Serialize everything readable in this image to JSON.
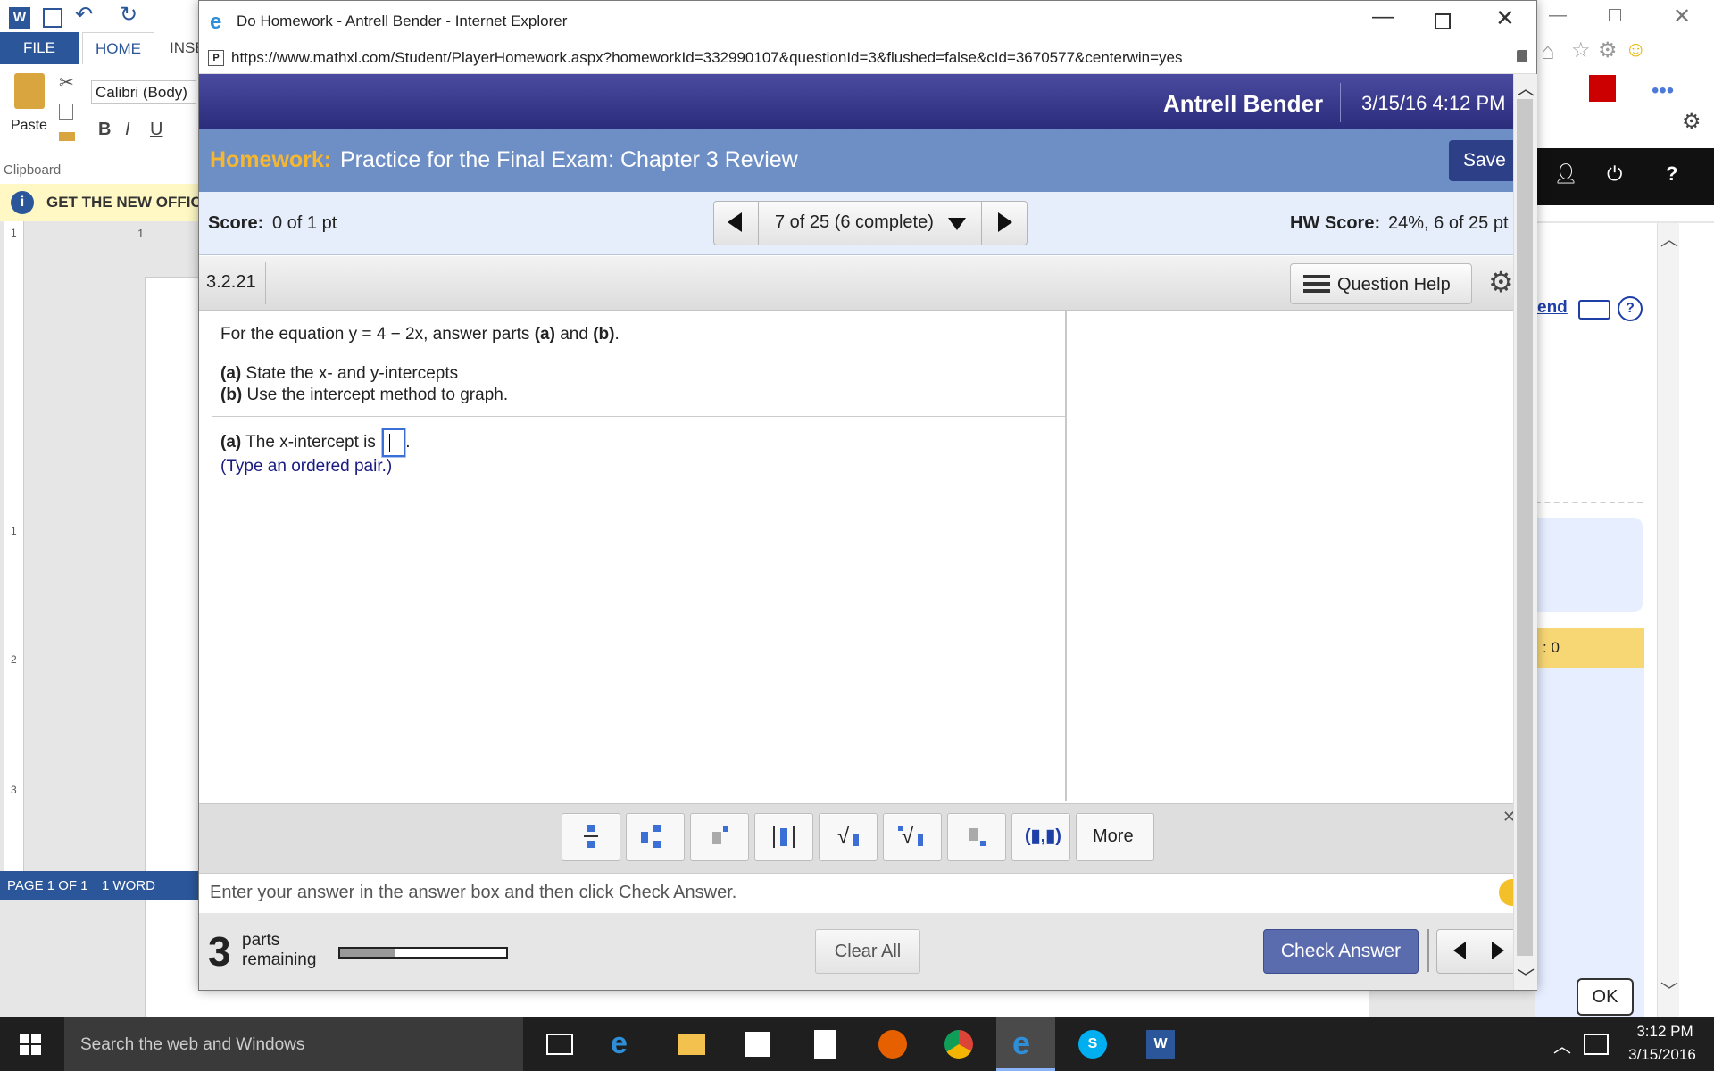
{
  "word": {
    "tabs": [
      "FILE",
      "HOME",
      "INSE"
    ],
    "font_name": "Calibri (Body)",
    "paste_label": "Paste",
    "clipboard_label": "Clipboard",
    "format_buttons": [
      "B",
      "I",
      "U"
    ],
    "infobar_text": "GET THE NEW OFFIC",
    "status_page": "PAGE 1 OF 1",
    "status_words": "1 WORD",
    "ruler_marks": [
      "1",
      "1",
      "2",
      "3"
    ],
    "ruler_top": "1",
    "right_panel": {
      "link_text": "end",
      "count_label": ": 0",
      "ok_button": "OK"
    }
  },
  "ie": {
    "title": "Do Homework - Antrell Bender - Internet Explorer",
    "url": "https://www.mathxl.com/Student/PlayerHomework.aspx?homeworkId=332990107&questionId=3&flushed=false&cId=3670577&centerwin=yes"
  },
  "mathxl": {
    "user_name": "Antrell Bender",
    "datetime": "3/15/16 4:12 PM",
    "homework_label": "Homework:",
    "homework_title": "Practice for the Final Exam: Chapter 3 Review",
    "save_label": "Save",
    "score_label": "Score:",
    "score_value": "0 of 1 pt",
    "question_nav": "7 of 25 (6 complete)",
    "hw_score_label": "HW Score:",
    "hw_score_value": "24%, 6 of 25 pt",
    "question_number": "3.2.21",
    "question_help_label": "Question Help",
    "prompt_intro": "For the equation y = 4 − 2x, answer parts",
    "prompt_a_bold": "(a)",
    "prompt_and": "and",
    "prompt_b_bold": "(b)",
    "part_a_label": "(a)",
    "part_a_text": "State the x- and y-intercepts",
    "part_b_label": "(b)",
    "part_b_text": "Use the intercept method to graph.",
    "answer_label": "(a)",
    "answer_text": "The x-intercept is",
    "answer_hint": "(Type an ordered pair.)",
    "more_label": "More",
    "hint_text": "Enter your answer in the answer box and then click Check Answer.",
    "parts_count": "3",
    "parts_word": "parts",
    "remaining_word": "remaining",
    "parts_progress": 0.33,
    "clear_all_label": "Clear All",
    "check_answer_label": "Check Answer"
  },
  "taskbar": {
    "search_placeholder": "Search the web and Windows",
    "time": "3:12 PM",
    "date": "3/15/2016"
  },
  "colors": {
    "word_blue": "#2b579a",
    "mathxl_header": "#2c2c7c",
    "homework_label": "#f5b731",
    "check_answer": "#5b6cae"
  }
}
